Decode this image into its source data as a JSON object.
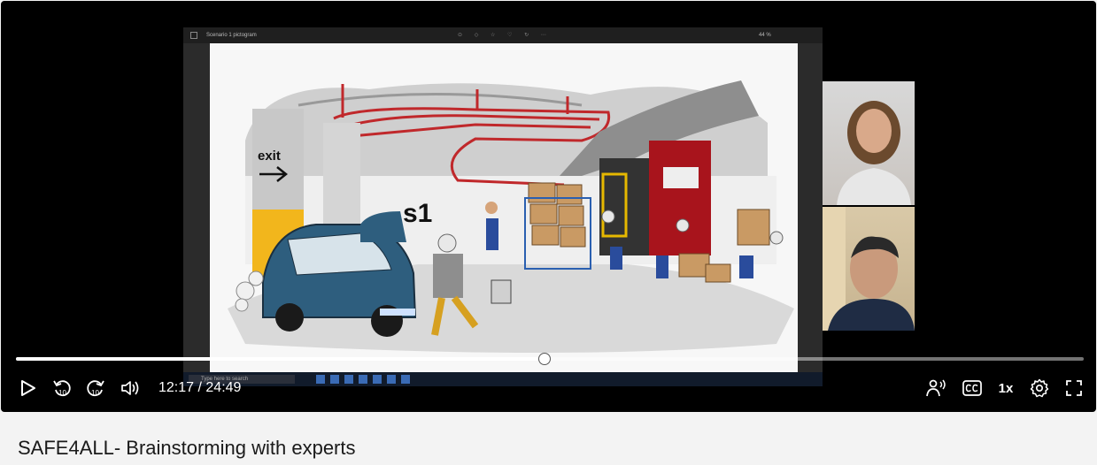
{
  "video": {
    "title": "SAFE4ALL- Brainstorming with experts",
    "current_time": "12:17",
    "duration": "24:49",
    "separator": " / ",
    "progress_fraction": 0.4949,
    "speed_label": "1x"
  },
  "shared_screen": {
    "window_title": "Scenario 1 pictogram",
    "zoom_label": "44 %",
    "taskbar_search": "Type here to search"
  },
  "scene": {
    "exit_text": "exit",
    "sign_text": "s1"
  },
  "icons": {
    "play": "play-icon",
    "rewind": "rewind-10-icon",
    "forward": "forward-10-icon",
    "volume": "volume-icon",
    "audio_description": "audio-description-icon",
    "captions": "captions-icon",
    "settings": "gear-icon",
    "fullscreen": "fullscreen-icon"
  },
  "colors": {
    "player_bg": "#000000",
    "page_bg": "#f3f3f3",
    "car_blue": "#2e5e7e",
    "pipe_red": "#c0282b",
    "door_red": "#a8141c",
    "pillar_yellow": "#f2b61c"
  }
}
